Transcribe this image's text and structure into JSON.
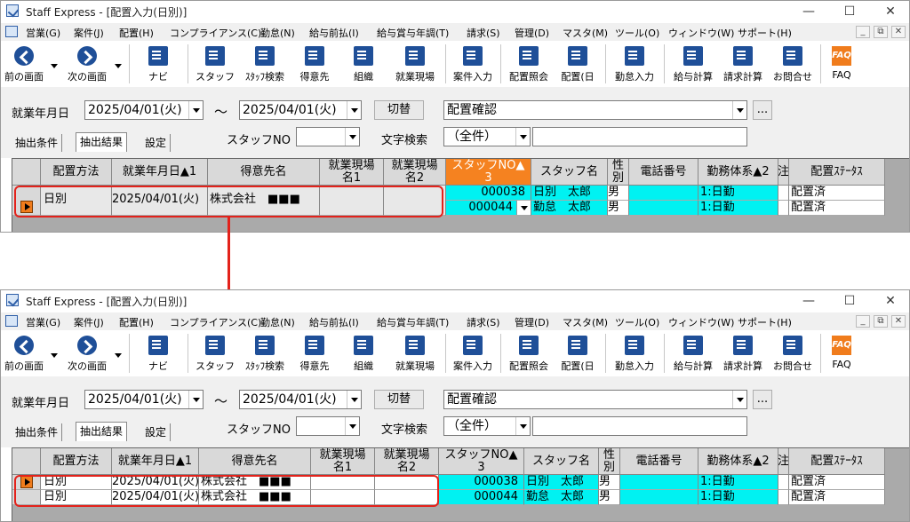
{
  "title": "Staff Express - [配置入力(日別)]",
  "window_controls": {
    "minimize": "—",
    "maximize": "☐",
    "close": "✕"
  },
  "menu": [
    "営業(G)",
    "案件(J)",
    "配置(H)",
    "コンプライアンス(C)",
    "勤怠(N)",
    "給与前払(I)",
    "給与賞与年調(T)",
    "請求(S)",
    "管理(D)",
    "マスタ(M)",
    "ツール(O)",
    "ウィンドウ(W)",
    "サポート(H)"
  ],
  "mdi_controls": [
    "_",
    "⧉",
    "✕"
  ],
  "toolbar": [
    "前の画面",
    "次の画面",
    "ナビ",
    "スタッフ",
    "ｽﾀｯﾌ検索",
    "得意先",
    "組織",
    "就業現場",
    "案件入力",
    "配置照会",
    "配置(日",
    "勤怠入力",
    "給与計算",
    "請求計算",
    "お問合せ",
    "FAQ"
  ],
  "faq_icon_text": "FAQ",
  "filter": {
    "date_label": "就業年月日",
    "date_from": "2025/04/01(火)",
    "tilde": "～",
    "date_to": "2025/04/01(火)",
    "toggle_button": "切替",
    "mode": "配置確認",
    "ellipsis_button": "...",
    "staff_no_label": "スタッフNO",
    "text_search_label": "文字検索",
    "text_search_scope": "（全件）"
  },
  "tabs": [
    "抽出条件",
    "抽出結果",
    "設定"
  ],
  "columns": [
    "配置方法",
    "就業年月日▲1",
    "得意先名",
    "就業現場\n名1",
    "就業現場\n名2",
    "スタッフNO▲\n3",
    "スタッフ名",
    "性\n別",
    "電話番号",
    "勤務体系▲2",
    "注",
    "配置ｽﾃｰﾀｽ"
  ],
  "rows": [
    {
      "method": "日別",
      "date": "2025/04/01(火)",
      "client": "株式会社　■■■",
      "staff_no": "000038",
      "staff_name": "日別　太郎",
      "sex": "男",
      "work_type": "1:日勤",
      "status": "配置済"
    },
    {
      "method": "日別",
      "date": "2025/04/01(火)",
      "client": "株式会社　■■■",
      "staff_no": "000044",
      "staff_name": "勤怠　太郎",
      "sex": "男",
      "work_type": "1:日勤",
      "status": "配置済"
    }
  ],
  "colors": {
    "annotation": "#e3221b",
    "sorted_header": "#f58220",
    "highlight": "#00f2f2"
  }
}
